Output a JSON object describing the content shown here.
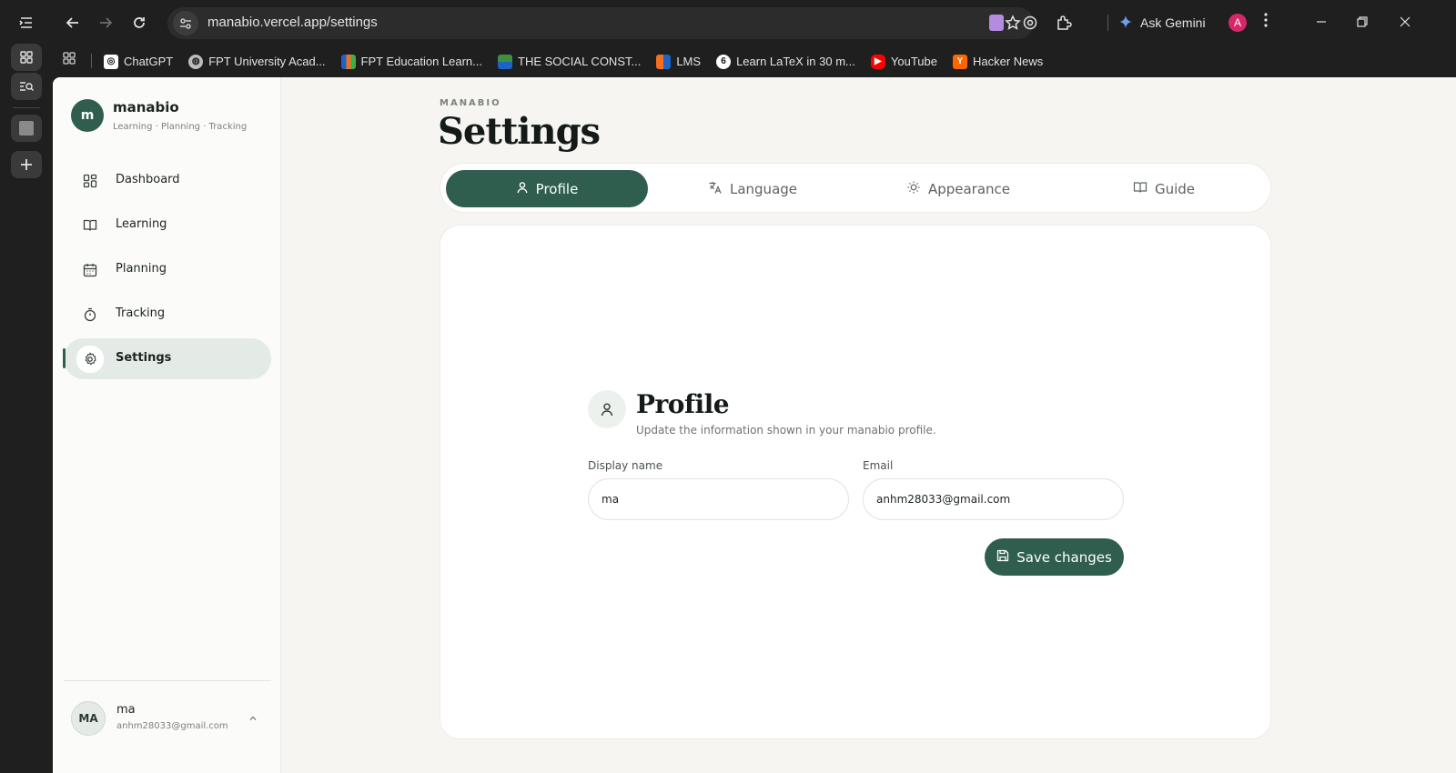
{
  "browser": {
    "url": "manabio.vercel.app/settings",
    "gemini_label": "Ask Gemini",
    "profile_initial": "A",
    "bookmarks": [
      {
        "label": "ChatGPT",
        "icon": "chatgpt-icon",
        "color": "#ffffff"
      },
      {
        "label": "FPT University Acad...",
        "icon": "fpt-university-icon",
        "color": "#bdbdbd"
      },
      {
        "label": "FPT Education Learn...",
        "icon": "fpt-education-icon",
        "color": "#f26f21"
      },
      {
        "label": "THE SOCIAL CONST...",
        "icon": "social-const-icon",
        "color": "#3f8f3f"
      },
      {
        "label": "LMS",
        "icon": "lms-icon",
        "color": "#1e63c7"
      },
      {
        "label": "Learn LaTeX in 30 m...",
        "icon": "overleaf-icon",
        "color": "#ffffff"
      },
      {
        "label": "YouTube",
        "icon": "youtube-icon",
        "color": "#ff0000"
      },
      {
        "label": "Hacker News",
        "icon": "hacker-news-icon",
        "color": "#ff6600"
      }
    ]
  },
  "sidebar": {
    "logo_letter": "m",
    "brand": "manabio",
    "tagline": "Learning · Planning · Tracking",
    "items": [
      {
        "label": "Dashboard",
        "icon": "dashboard-icon",
        "active": false
      },
      {
        "label": "Learning",
        "icon": "book-icon",
        "active": false
      },
      {
        "label": "Planning",
        "icon": "calendar-icon",
        "active": false
      },
      {
        "label": "Tracking",
        "icon": "timer-icon",
        "active": false
      },
      {
        "label": "Settings",
        "icon": "gear-icon",
        "active": true
      }
    ],
    "user": {
      "initials": "MA",
      "name": "ma",
      "email": "anhm28033@gmail.com"
    }
  },
  "header": {
    "eyebrow": "MANABIO",
    "title": "Settings"
  },
  "tabs": [
    {
      "label": "Profile",
      "icon": "user-icon",
      "active": true
    },
    {
      "label": "Language",
      "icon": "translate-icon",
      "active": false
    },
    {
      "label": "Appearance",
      "icon": "sun-icon",
      "active": false
    },
    {
      "label": "Guide",
      "icon": "book-open-icon",
      "active": false
    }
  ],
  "profile": {
    "title": "Profile",
    "subtitle": "Update the information shown in your manabio profile.",
    "display_name_label": "Display name",
    "display_name_value": "ma",
    "email_label": "Email",
    "email_value": "anhm28033@gmail.com",
    "save_label": "Save changes"
  },
  "colors": {
    "accent": "#2f5e4f",
    "background": "#f6f5f2"
  }
}
